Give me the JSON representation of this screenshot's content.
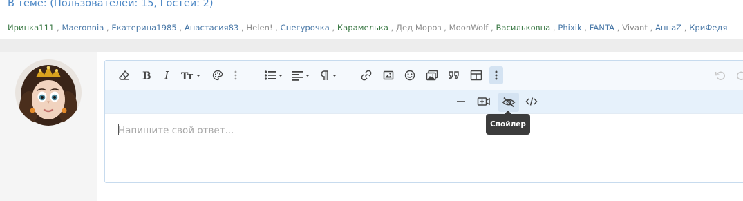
{
  "online": {
    "title_prefix": "В теме: (Пользователей: ",
    "users_count": "15",
    "title_middle": ", Гостей: ",
    "guests_count": "2",
    "title_suffix": ")",
    "users": [
      {
        "name": "Иринка111",
        "color": "#3c7a46"
      },
      {
        "name": "Maeronnia",
        "color": "#4a79a8"
      },
      {
        "name": "Екатерина1985",
        "color": "#4a79a8"
      },
      {
        "name": "Анастасия83",
        "color": "#4a79a8"
      },
      {
        "name": "Helen!",
        "color": "#8c8c8c"
      },
      {
        "name": "Снегурочка",
        "color": "#4a79a8"
      },
      {
        "name": "Карамелька",
        "color": "#3c7a46"
      },
      {
        "name": "Дед Мороз",
        "color": "#8c8c8c"
      },
      {
        "name": "MoonWolf",
        "color": "#8c8c8c"
      },
      {
        "name": "Васильковна",
        "color": "#3c7a46"
      },
      {
        "name": "Phixik",
        "color": "#4a79a8"
      },
      {
        "name": "FANTA",
        "color": "#4a79a8"
      },
      {
        "name": "Vivant",
        "color": "#8c8c8c"
      },
      {
        "name": "АннаZ",
        "color": "#4a79a8"
      },
      {
        "name": "КриФедя",
        "color": "#4a79a8"
      }
    ],
    "separator": ","
  },
  "editor": {
    "placeholder": "Напишите свой ответ...",
    "tooltip": "Спойлер"
  },
  "colors": {
    "link_blue": "#4a86c5",
    "toolbar_bg": "#f5f9fd",
    "toolbar2_bg": "#e6f1fb",
    "tooltip_bg": "#3c3c3c"
  }
}
